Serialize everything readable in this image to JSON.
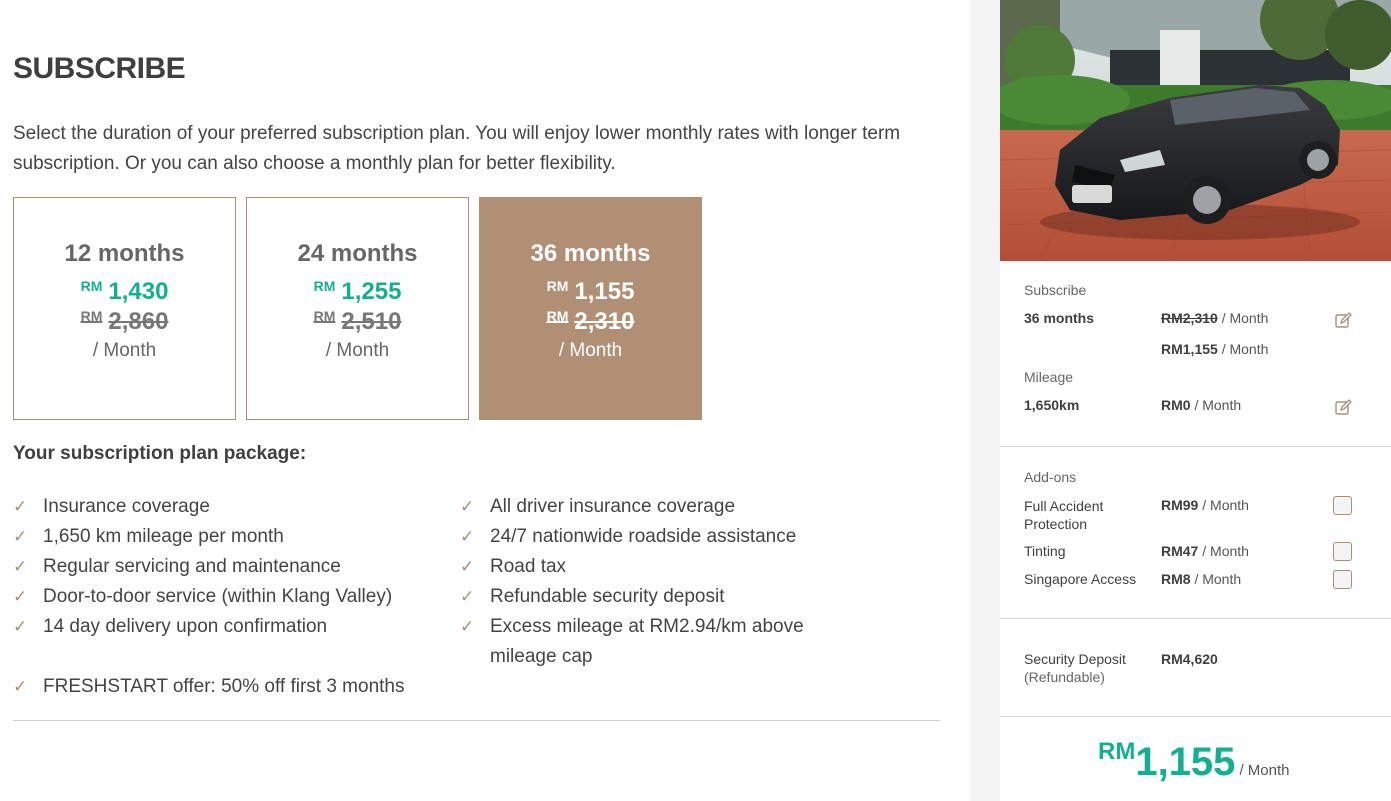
{
  "page": {
    "title": "SUBSCRIBE",
    "intro": "Select the duration of your preferred subscription plan. You will enjoy lower monthly rates with longer term subscription. Or you can also choose a monthly plan for better flexibility."
  },
  "plans": [
    {
      "duration": "12 months",
      "currency": "RM",
      "price": "1,430",
      "old_price": "2,860",
      "per": "/ Month",
      "selected": false
    },
    {
      "duration": "24 months",
      "currency": "RM",
      "price": "1,255",
      "old_price": "2,510",
      "per": "/ Month",
      "selected": false
    },
    {
      "duration": "36 months",
      "currency": "RM",
      "price": "1,155",
      "old_price": "2,310",
      "per": "/ Month",
      "selected": true
    }
  ],
  "package": {
    "title": "Your subscription plan package:",
    "left": [
      "Insurance coverage",
      "1,650 km mileage per month",
      "Regular servicing and maintenance",
      "Door-to-door service (within Klang Valley)",
      "14 day delivery upon confirmation"
    ],
    "right": [
      "All driver insurance coverage",
      "24/7 nationwide roadside assistance",
      "Road tax",
      "Refundable security deposit",
      "Excess mileage at RM2.94/km above mileage cap"
    ],
    "extra": [
      "FRESHSTART offer: 50% off first 3 months"
    ],
    "check_icon": "check-icon"
  },
  "summary": {
    "subscribe_label": "Subscribe",
    "subscribe_value": "36 months",
    "old_price": "RM2,310",
    "new_price": "RM1,155",
    "per_month": "/ Month",
    "mileage_label": "Mileage",
    "mileage_value": "1,650km",
    "mileage_price": "RM0",
    "edit_icon": "edit-icon"
  },
  "addons": {
    "label": "Add-ons",
    "items": [
      {
        "name": "Full Accident Protection",
        "price": "RM99",
        "per": "/ Month"
      },
      {
        "name": "Tinting",
        "price": "RM47",
        "per": "/ Month"
      },
      {
        "name": "Singapore Access",
        "price": "RM8",
        "per": "/ Month"
      }
    ]
  },
  "deposit": {
    "label": "Security Deposit",
    "sublabel": "(Refundable)",
    "value": "RM4,620"
  },
  "total": {
    "currency": "RM",
    "amount": "1,155",
    "per": "/ Month"
  },
  "colors": {
    "accent": "#13b08f",
    "brand": "#b08f74",
    "border": "#a88f78"
  }
}
